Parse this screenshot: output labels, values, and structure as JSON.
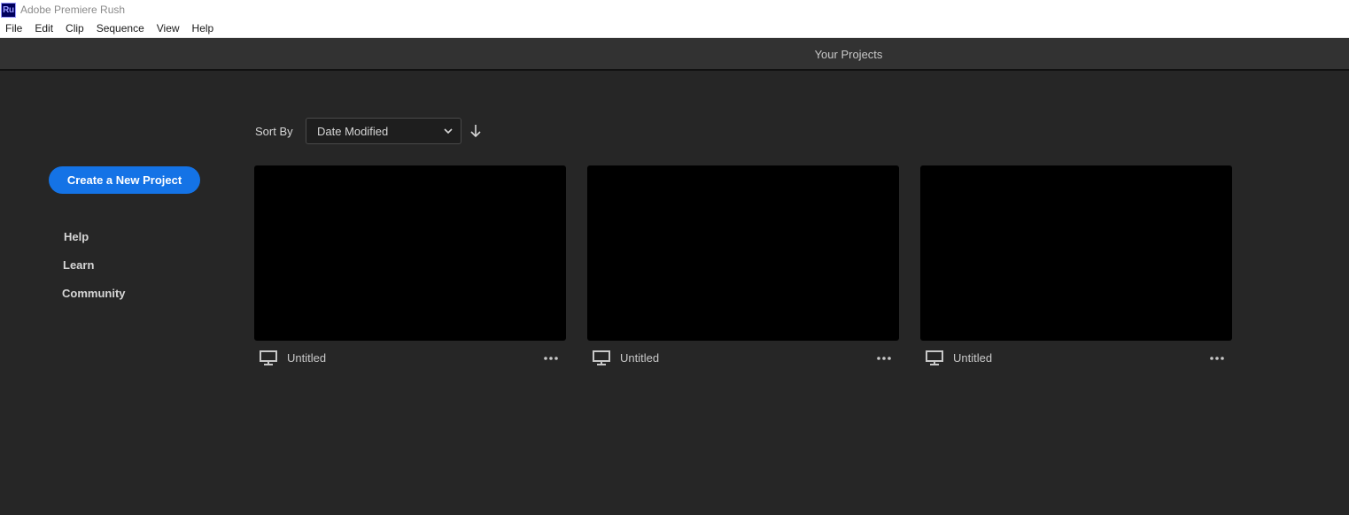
{
  "window": {
    "app_icon_text": "Ru",
    "title": "Adobe Premiere Rush"
  },
  "menu": {
    "items": [
      "File",
      "Edit",
      "Clip",
      "Sequence",
      "View",
      "Help"
    ]
  },
  "header": {
    "title": "Your Projects"
  },
  "sidebar": {
    "create_label": "Create a New Project",
    "links": [
      "Help",
      "Learn",
      "Community"
    ]
  },
  "sort": {
    "label": "Sort By",
    "selected": "Date Modified",
    "direction_icon": "arrow-down-icon"
  },
  "projects": [
    {
      "name": "Untitled",
      "icon": "monitor-icon"
    },
    {
      "name": "Untitled",
      "icon": "monitor-icon"
    },
    {
      "name": "Untitled",
      "icon": "monitor-icon"
    }
  ],
  "colors": {
    "accent": "#1473e6",
    "background": "#262626",
    "header": "#323232"
  }
}
